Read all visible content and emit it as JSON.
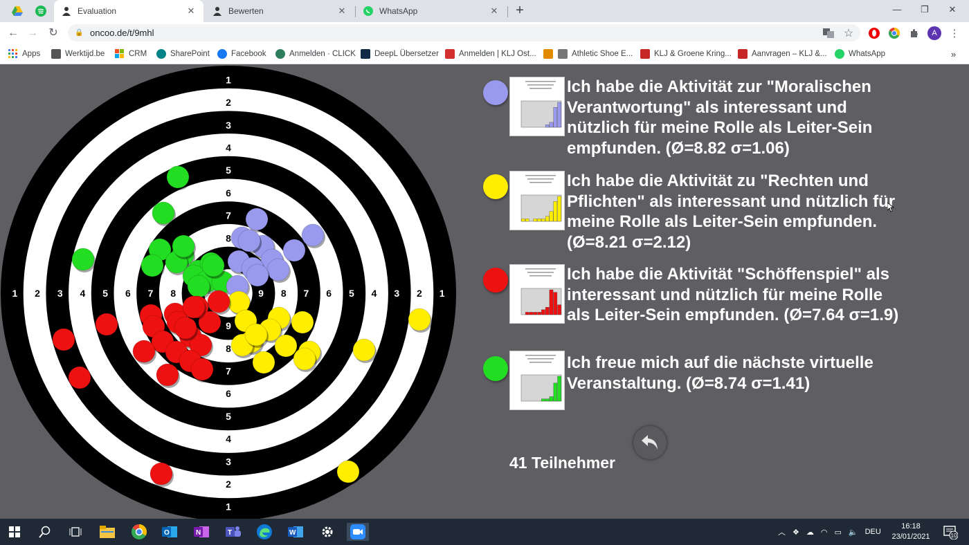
{
  "browser": {
    "tabs": [
      {
        "title": "Evaluation",
        "active": true
      },
      {
        "title": "Bewerten",
        "active": false
      },
      {
        "title": "WhatsApp",
        "active": false
      }
    ],
    "url": "oncoo.de/t/9mhl",
    "profile_initial": "A",
    "bookmarks": [
      {
        "label": "Apps",
        "color": "#4285f4"
      },
      {
        "label": "Werktijd.be",
        "color": "#555555"
      },
      {
        "label": "CRM",
        "color": "#f25022"
      },
      {
        "label": "SharePoint",
        "color": "#038387"
      },
      {
        "label": "Facebook",
        "color": "#1877f2"
      },
      {
        "label": "Anmelden · CLICK",
        "color": "#2e7d5b"
      },
      {
        "label": "DeepL Übersetzer",
        "color": "#0f2b46"
      },
      {
        "label": "Anmelden | KLJ Ost...",
        "color": "#d32f2f"
      },
      {
        "label": "",
        "color": "#e08a00"
      },
      {
        "label": "Athletic Shoe E...",
        "color": "#777777"
      },
      {
        "label": "KLJ & Groene Kring...",
        "color": "#c62828"
      },
      {
        "label": "Aanvragen – KLJ &...",
        "color": "#c62828"
      },
      {
        "label": "WhatsApp",
        "color": "#25d366"
      }
    ],
    "more_bookmarks": "»"
  },
  "target": {
    "ring_labels_top": [
      "1",
      "2",
      "3",
      "4",
      "5",
      "6",
      "7",
      "8"
    ],
    "ring_labels_bottom": [
      "9",
      "8",
      "7",
      "6",
      "5",
      "4",
      "3",
      "2",
      "1"
    ],
    "ring_labels_left": [
      "1",
      "2",
      "3",
      "4",
      "5",
      "6",
      "7",
      "8",
      "9"
    ],
    "ring_labels_right": [
      "9",
      "8",
      "7",
      "6",
      "5",
      "4",
      "3",
      "2",
      "1"
    ]
  },
  "questions": [
    {
      "color": "#9999ee",
      "text": "Ich habe die Aktivität zur \"Moralischen Verantwortung\" als interessant und nützlich für meine Rolle als Leiter-Sein empfunden. (Ø=8.82 σ=1.06)",
      "histogram": [
        0,
        0,
        0,
        0,
        0,
        0,
        1,
        2,
        8,
        10
      ]
    },
    {
      "color": "#ffee00",
      "text": "Ich habe die Aktivität zu \"Rechten und Pflichten\" als interessant und nützlich für meine Rolle als Leiter-Sein empfunden. (Ø=8.21 σ=2.12)",
      "histogram": [
        1,
        1,
        0,
        1,
        1,
        1,
        2,
        4,
        8,
        10
      ]
    },
    {
      "color": "#ee1111",
      "text": "Ich habe die Aktivität \"Schöffenspiel\" als interessant und nützlich für meine Rolle als Leiter-Sein empfunden. (Ø=7.64 σ=1.9)",
      "histogram": [
        0,
        1,
        1,
        1,
        1,
        2,
        3,
        10,
        9,
        4
      ]
    },
    {
      "color": "#22dd22",
      "text": "Ich freue mich auf die nächste virtuelle Veranstaltung. (Ø=8.74 σ=1.41)",
      "histogram": [
        0,
        0,
        0,
        0,
        0,
        1,
        1,
        2,
        8,
        11
      ]
    }
  ],
  "participants_label": "41 Teilnehmer",
  "taskbar": {
    "language": "DEU",
    "time": "16:18",
    "date": "23/01/2021",
    "notifications": "10"
  }
}
